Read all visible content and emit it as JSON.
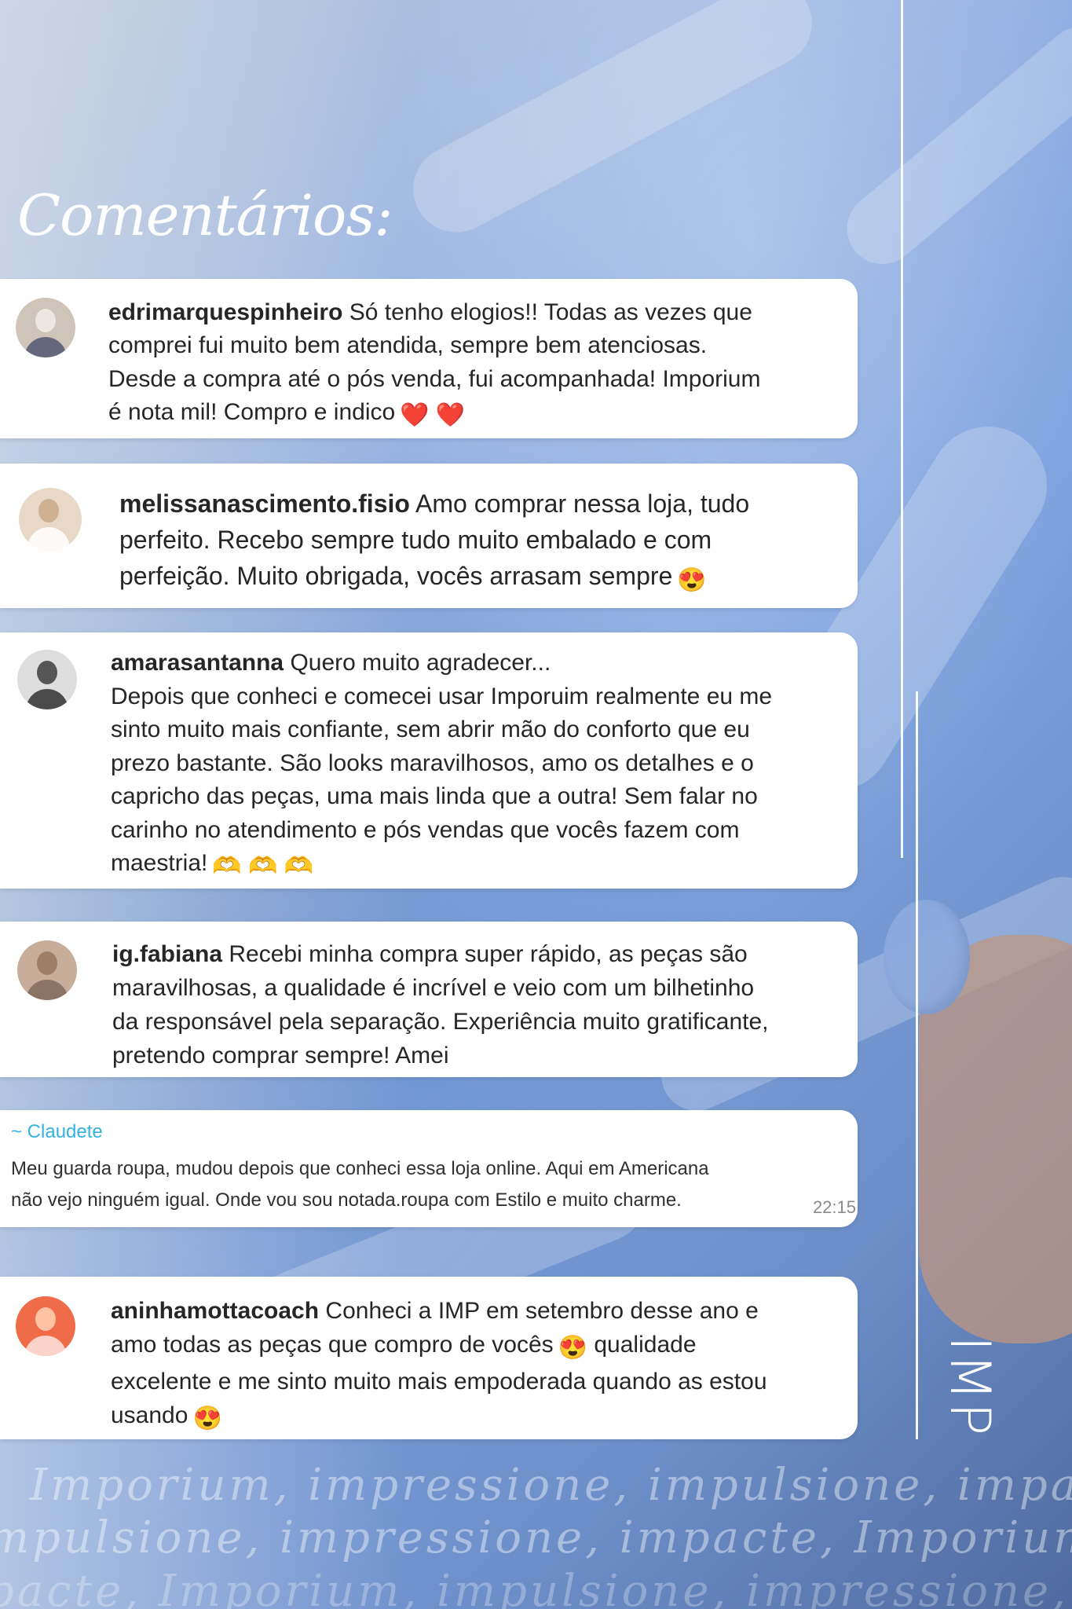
{
  "heading": "Comentários:",
  "comments": [
    {
      "username": "edrimarquespinheiro",
      "lines": [
        "Só tenho elogios!! Todas as vezes que",
        "comprei fui muito bem atendida, sempre bem atenciosas.",
        "Desde a compra até o pós venda, fui acompanhada! Imporium",
        "é nota mil! Compro e indico"
      ],
      "emojis": "❤️ ❤️"
    },
    {
      "username": "melissanascimento.fisio",
      "lines": [
        "Amo comprar nessa loja, tudo",
        "perfeito. Recebo sempre tudo muito embalado e com",
        "perfeição. Muito obrigada, vocês arrasam sempre"
      ],
      "emojis": "😍"
    },
    {
      "username": "amarasantanna",
      "lines": [
        "Quero muito agradecer...",
        "Depois que conheci e comecei usar Imporuim realmente eu me",
        "sinto muito mais confiante, sem abrir mão do conforto que eu",
        "prezo bastante. São looks maravilhosos, amo os detalhes e o",
        "capricho das peças, uma mais linda que a outra! Sem falar no",
        "carinho no atendimento e pós vendas que vocês fazem com",
        "maestria!"
      ],
      "emojis": "🫶 🫶 🫶"
    },
    {
      "username": "ig.fabiana",
      "lines": [
        "Recebi minha compra super rápido, as peças são",
        "maravilhosas, a qualidade é incrível e veio com um bilhetinho",
        "da responsável pela separação. Experiência muito gratificante,",
        "pretendo comprar sempre! Amei"
      ],
      "emojis": ""
    },
    {
      "username": "aninhamottacoach",
      "lines": [
        "Conheci a IMP em setembro desse ano e",
        "amo todas as peças que compro de vocês",
        "qualidade",
        "excelente e me sinto muito mais empoderada quando as estou",
        "usando"
      ],
      "emojis": "😍",
      "emojis_end": "😍"
    }
  ],
  "whatsapp_message": {
    "sender": "~ Claudete",
    "lines": [
      "Meu guarda roupa, mudou depois que conheci essa loja online. Aqui em Americana",
      "não vejo ninguém igual. Onde vou sou notada.roupa com Estilo e muito charme."
    ],
    "time": "22:15"
  },
  "brand": "IMP",
  "slogan_lines": [
    "Imporium, impressione, impulsione, impacte,",
    "mpulsione, impressione, impacte, Imporium",
    "pacte, Imporium, impulsione, impressione, I"
  ]
}
